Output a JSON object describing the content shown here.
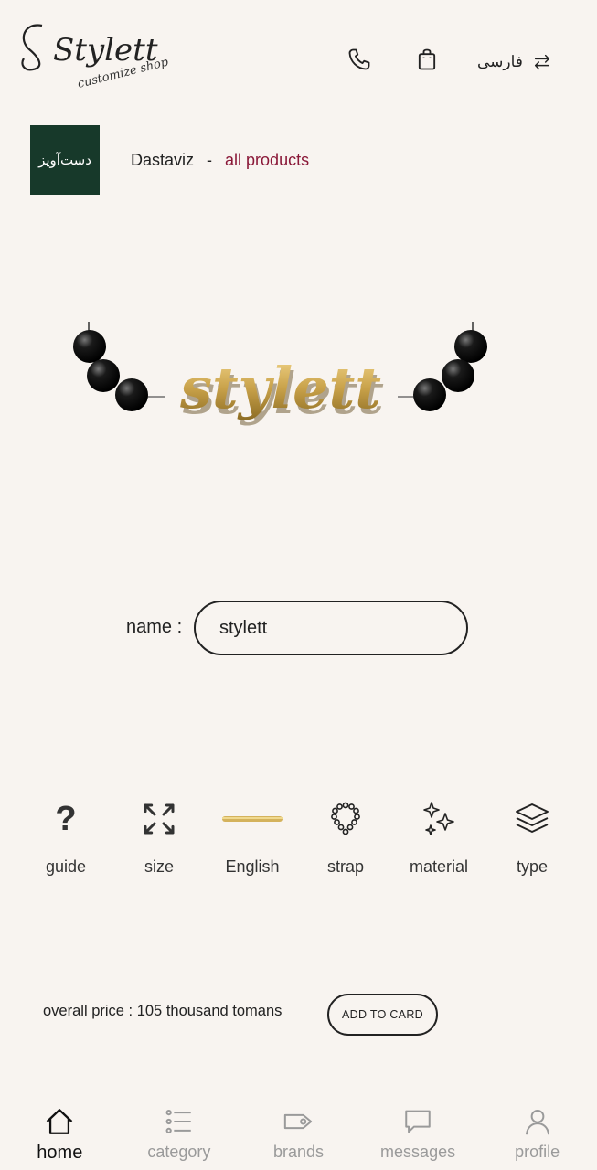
{
  "header": {
    "logo_text": "Stylett",
    "logo_subtitle": "customize shop",
    "language_label": "فارسی"
  },
  "brand": {
    "thumb_text": "دست‌آویز",
    "name": "Dastaviz",
    "separator": "-",
    "all_products": "all products"
  },
  "product": {
    "nameplate_text": "stylett"
  },
  "name_field": {
    "label": "name :",
    "value": "stylett"
  },
  "options": [
    {
      "label": "guide",
      "icon": "question-icon"
    },
    {
      "label": "size",
      "icon": "expand-icon"
    },
    {
      "label": "English",
      "icon": "font-preview-icon"
    },
    {
      "label": "strap",
      "icon": "bead-strap-icon"
    },
    {
      "label": "material",
      "icon": "sparkle-icon"
    },
    {
      "label": "type",
      "icon": "layers-icon"
    }
  ],
  "price": {
    "text": "overall price : 105 thousand tomans",
    "button": "ADD TO CARD"
  },
  "nav": [
    {
      "label": "home",
      "icon": "home-icon",
      "active": true
    },
    {
      "label": "category",
      "icon": "list-icon",
      "active": false
    },
    {
      "label": "brands",
      "icon": "tag-icon",
      "active": false
    },
    {
      "label": "messages",
      "icon": "chat-icon",
      "active": false
    },
    {
      "label": "profile",
      "icon": "user-icon",
      "active": false
    }
  ],
  "colors": {
    "background": "#f8f4f0",
    "accent_link": "#8a1838",
    "brand_thumb": "#17392a",
    "gold": "#c9a24a"
  }
}
